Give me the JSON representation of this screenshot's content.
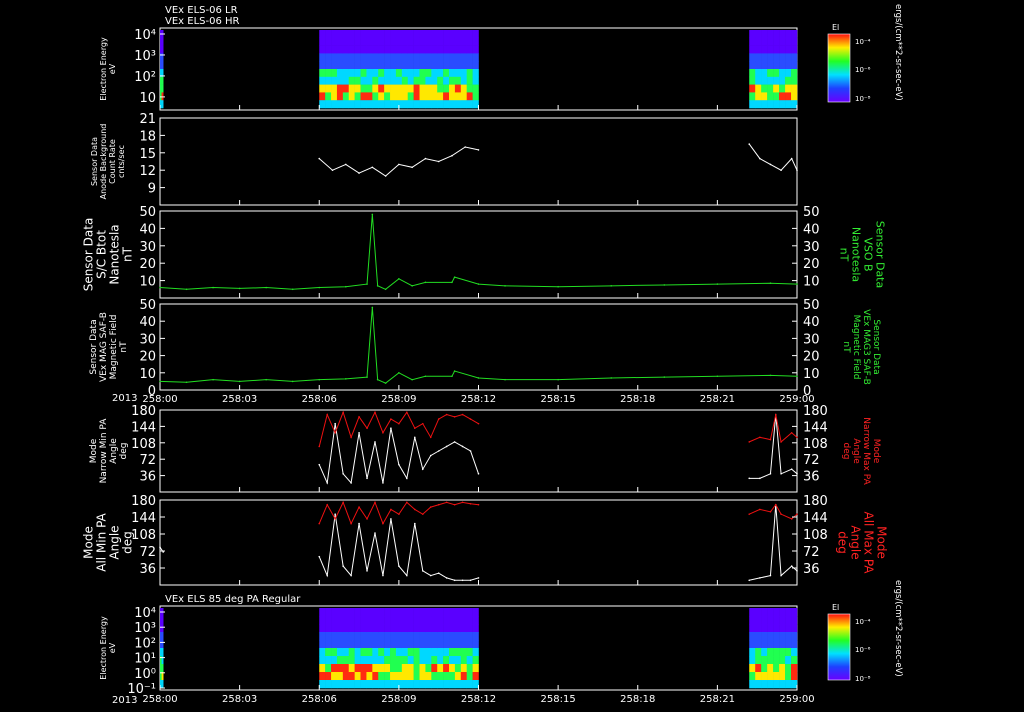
{
  "titles": {
    "top_line1": "VEx ELS-06 LR",
    "top_line2": "VEx ELS-06 HR",
    "bottom": "VEx ELS 85 deg PA Regular"
  },
  "time_axis": {
    "year": "2013",
    "ticks": [
      "258:00",
      "258:03",
      "258:06",
      "258:09",
      "258:12",
      "258:15",
      "258:18",
      "258:21",
      "259:00"
    ]
  },
  "colors": {
    "white": "#ffffff",
    "green": "#22dd22",
    "red": "#ee1111",
    "label_green": "#33ee33",
    "label_red": "#ff2222"
  },
  "colorbar": {
    "label": "El",
    "units": "ergs/(cm**2-sr-sec-eV)",
    "ticks": [
      "10⁻⁴",
      "10⁻⁶",
      "10⁻⁸"
    ]
  },
  "chart_data": [
    {
      "type": "heatmap",
      "ylabel": [
        "Electron Energy",
        "eV"
      ],
      "y_ticks": [
        "10⁴",
        "10³",
        "10²",
        "10"
      ],
      "scale": "log",
      "data_intervals_hours": [
        [
          0.0,
          0.12
        ],
        [
          6.0,
          12.0
        ],
        [
          22.2,
          24.0
        ]
      ]
    },
    {
      "type": "line",
      "ylabel": [
        "Sensor Data",
        "Anode Background",
        "Count Rate",
        "cnts/sec"
      ],
      "ylim": [
        6,
        21
      ],
      "y_ticks": [
        "21",
        "18",
        "15",
        "12",
        "9"
      ],
      "series": [
        {
          "color": "white",
          "x": [
            6.0,
            6.5,
            7.0,
            7.5,
            8.0,
            8.5,
            9.0,
            9.5,
            10.0,
            10.5,
            11.0,
            11.5,
            12.0,
            22.2,
            22.6,
            23.0,
            23.4,
            23.8,
            24.0
          ],
          "y": [
            14,
            12,
            13,
            11.5,
            12.5,
            11,
            13,
            12.5,
            14,
            13.5,
            14.5,
            16,
            15.5,
            16.5,
            14,
            13,
            12,
            14,
            12
          ]
        }
      ]
    },
    {
      "type": "line",
      "ylabel": [
        "Sensor Data",
        "S/C Btot",
        "Nanotesla",
        "nT"
      ],
      "ylabel_right": [
        "Sensor Data",
        "VSO B",
        "Nanotesla",
        "nT"
      ],
      "ylim": [
        0,
        50
      ],
      "y_ticks": [
        "50",
        "40",
        "30",
        "20",
        "10"
      ],
      "series": [
        {
          "color": "green",
          "x": [
            0,
            1,
            2,
            3,
            4,
            5,
            6,
            7,
            7.8,
            8.0,
            8.2,
            8.5,
            9,
            9.5,
            10,
            11,
            11.1,
            12,
            13,
            15,
            17,
            19,
            21,
            23,
            24
          ],
          "y": [
            6,
            5,
            6,
            5.5,
            6,
            5,
            6,
            6.5,
            8,
            48,
            7,
            5,
            11,
            7,
            9,
            9,
            12,
            8,
            7,
            6.5,
            7,
            7.5,
            8,
            8.5,
            8
          ]
        }
      ]
    },
    {
      "type": "line",
      "ylabel": [
        "Sensor Data",
        "VEx MAG SAF-B",
        "Magnetic Field",
        "nT"
      ],
      "ylabel_right": [
        "Sensor Data",
        "VEx MAG3 SAF-B",
        "Magnetic Field",
        "nT"
      ],
      "ylim": [
        0,
        50
      ],
      "y_ticks": [
        "50",
        "40",
        "30",
        "20",
        "10",
        "0"
      ],
      "series": [
        {
          "color": "green",
          "x": [
            0,
            1,
            2,
            3,
            4,
            5,
            6,
            7,
            7.8,
            8.0,
            8.2,
            8.5,
            9,
            9.5,
            10,
            11,
            11.1,
            12,
            13,
            15,
            17,
            19,
            21,
            23,
            24
          ],
          "y": [
            5,
            4.5,
            6,
            5,
            6,
            5,
            6,
            6.5,
            7.5,
            48,
            6,
            4,
            10,
            6,
            8,
            8,
            11,
            7,
            6,
            6,
            7,
            7.5,
            8,
            8.5,
            8
          ]
        }
      ]
    },
    {
      "type": "line",
      "ylabel": [
        "Mode",
        "Narrow Min PA",
        "Angle",
        "deg"
      ],
      "ylabel_right": [
        "Mode",
        "Narrow Max PA",
        "Angle",
        "deg"
      ],
      "ylim": [
        0,
        180
      ],
      "y_ticks": [
        "180",
        "144",
        "108",
        "72",
        "36"
      ],
      "series": [
        {
          "color": "white",
          "x": [
            6.0,
            6.3,
            6.6,
            6.9,
            7.2,
            7.5,
            7.8,
            8.1,
            8.4,
            8.7,
            9.0,
            9.3,
            9.6,
            9.9,
            10.2,
            10.5,
            10.8,
            11.1,
            11.4,
            11.7,
            12.0,
            22.2,
            22.6,
            23.0,
            23.2,
            23.4,
            23.8,
            24.0
          ],
          "y": [
            60,
            20,
            150,
            40,
            20,
            130,
            30,
            110,
            20,
            140,
            60,
            30,
            120,
            50,
            80,
            90,
            100,
            110,
            100,
            90,
            40,
            30,
            30,
            40,
            170,
            40,
            50,
            40
          ]
        },
        {
          "color": "red",
          "x": [
            6.0,
            6.3,
            6.6,
            6.9,
            7.2,
            7.5,
            7.8,
            8.1,
            8.4,
            8.7,
            9.0,
            9.3,
            9.6,
            9.9,
            10.2,
            10.5,
            10.8,
            11.1,
            11.4,
            11.7,
            12.0,
            22.2,
            22.6,
            23.0,
            23.2,
            23.4,
            23.8,
            24.0
          ],
          "y": [
            100,
            170,
            130,
            175,
            120,
            165,
            140,
            175,
            130,
            160,
            150,
            175,
            140,
            150,
            120,
            160,
            170,
            165,
            170,
            160,
            150,
            110,
            120,
            115,
            170,
            110,
            130,
            120
          ]
        }
      ]
    },
    {
      "type": "line",
      "ylabel": [
        "Mode",
        "All Min PA",
        "Angle",
        "deg"
      ],
      "ylabel_right": [
        "Mode",
        "All Max PA",
        "Angle",
        "deg"
      ],
      "ylim": [
        0,
        180
      ],
      "y_ticks": [
        "180",
        "144",
        "108",
        "72",
        "36"
      ],
      "series": [
        {
          "color": "white",
          "x": [
            0,
            0.12,
            6.0,
            6.3,
            6.6,
            6.9,
            7.2,
            7.5,
            7.8,
            8.1,
            8.4,
            8.7,
            9.0,
            9.3,
            9.6,
            9.9,
            10.2,
            10.5,
            10.8,
            11.1,
            11.4,
            11.7,
            12.0,
            22.2,
            22.6,
            23.0,
            23.2,
            23.4,
            23.8,
            24.0
          ],
          "y": [
            80,
            70,
            60,
            20,
            150,
            40,
            20,
            130,
            30,
            110,
            20,
            140,
            40,
            20,
            130,
            30,
            20,
            25,
            15,
            10,
            10,
            10,
            15,
            10,
            15,
            20,
            170,
            20,
            40,
            30
          ]
        },
        {
          "color": "red",
          "x": [
            6.0,
            6.3,
            6.6,
            6.9,
            7.2,
            7.5,
            7.8,
            8.1,
            8.4,
            8.7,
            9.0,
            9.3,
            9.6,
            9.9,
            10.2,
            10.5,
            10.8,
            11.1,
            11.4,
            11.7,
            12.0,
            22.2,
            22.6,
            23.0,
            23.2,
            23.4,
            23.8,
            24.0
          ],
          "y": [
            130,
            170,
            140,
            175,
            130,
            165,
            140,
            175,
            130,
            160,
            150,
            175,
            160,
            150,
            165,
            170,
            175,
            170,
            175,
            172,
            170,
            150,
            160,
            155,
            170,
            150,
            140,
            150
          ]
        }
      ]
    },
    {
      "type": "heatmap",
      "ylabel": [
        "Electron Energy",
        "eV"
      ],
      "y_ticks": [
        "10⁴",
        "10³",
        "10²",
        "10¹",
        "10⁰",
        "10⁻¹"
      ],
      "scale": "log",
      "data_intervals_hours": [
        [
          0.0,
          0.12
        ],
        [
          6.0,
          12.0
        ],
        [
          22.2,
          24.0
        ]
      ]
    }
  ]
}
